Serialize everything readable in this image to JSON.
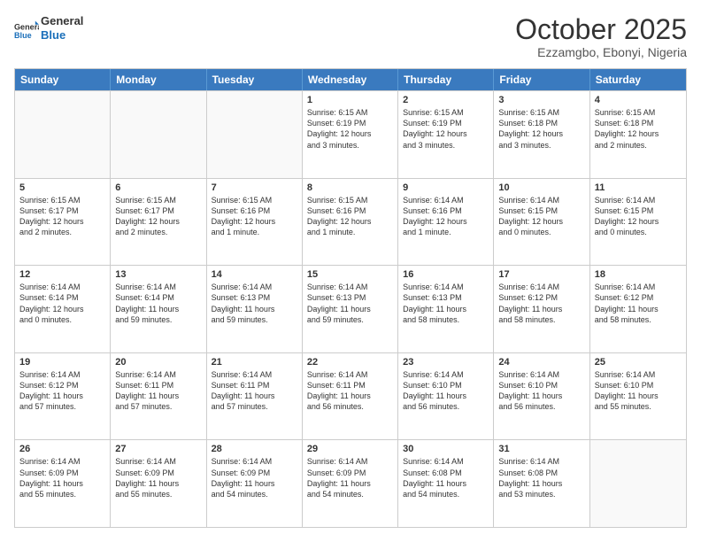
{
  "logo": {
    "general": "General",
    "blue": "Blue"
  },
  "title": "October 2025",
  "location": "Ezzamgbo, Ebonyi, Nigeria",
  "days": [
    "Sunday",
    "Monday",
    "Tuesday",
    "Wednesday",
    "Thursday",
    "Friday",
    "Saturday"
  ],
  "rows": [
    [
      {
        "day": "",
        "lines": [],
        "empty": true
      },
      {
        "day": "",
        "lines": [],
        "empty": true
      },
      {
        "day": "",
        "lines": [],
        "empty": true
      },
      {
        "day": "1",
        "lines": [
          "Sunrise: 6:15 AM",
          "Sunset: 6:19 PM",
          "Daylight: 12 hours",
          "and 3 minutes."
        ]
      },
      {
        "day": "2",
        "lines": [
          "Sunrise: 6:15 AM",
          "Sunset: 6:19 PM",
          "Daylight: 12 hours",
          "and 3 minutes."
        ]
      },
      {
        "day": "3",
        "lines": [
          "Sunrise: 6:15 AM",
          "Sunset: 6:18 PM",
          "Daylight: 12 hours",
          "and 3 minutes."
        ]
      },
      {
        "day": "4",
        "lines": [
          "Sunrise: 6:15 AM",
          "Sunset: 6:18 PM",
          "Daylight: 12 hours",
          "and 2 minutes."
        ]
      }
    ],
    [
      {
        "day": "5",
        "lines": [
          "Sunrise: 6:15 AM",
          "Sunset: 6:17 PM",
          "Daylight: 12 hours",
          "and 2 minutes."
        ]
      },
      {
        "day": "6",
        "lines": [
          "Sunrise: 6:15 AM",
          "Sunset: 6:17 PM",
          "Daylight: 12 hours",
          "and 2 minutes."
        ]
      },
      {
        "day": "7",
        "lines": [
          "Sunrise: 6:15 AM",
          "Sunset: 6:16 PM",
          "Daylight: 12 hours",
          "and 1 minute."
        ]
      },
      {
        "day": "8",
        "lines": [
          "Sunrise: 6:15 AM",
          "Sunset: 6:16 PM",
          "Daylight: 12 hours",
          "and 1 minute."
        ]
      },
      {
        "day": "9",
        "lines": [
          "Sunrise: 6:14 AM",
          "Sunset: 6:16 PM",
          "Daylight: 12 hours",
          "and 1 minute."
        ]
      },
      {
        "day": "10",
        "lines": [
          "Sunrise: 6:14 AM",
          "Sunset: 6:15 PM",
          "Daylight: 12 hours",
          "and 0 minutes."
        ]
      },
      {
        "day": "11",
        "lines": [
          "Sunrise: 6:14 AM",
          "Sunset: 6:15 PM",
          "Daylight: 12 hours",
          "and 0 minutes."
        ]
      }
    ],
    [
      {
        "day": "12",
        "lines": [
          "Sunrise: 6:14 AM",
          "Sunset: 6:14 PM",
          "Daylight: 12 hours",
          "and 0 minutes."
        ]
      },
      {
        "day": "13",
        "lines": [
          "Sunrise: 6:14 AM",
          "Sunset: 6:14 PM",
          "Daylight: 11 hours",
          "and 59 minutes."
        ]
      },
      {
        "day": "14",
        "lines": [
          "Sunrise: 6:14 AM",
          "Sunset: 6:13 PM",
          "Daylight: 11 hours",
          "and 59 minutes."
        ]
      },
      {
        "day": "15",
        "lines": [
          "Sunrise: 6:14 AM",
          "Sunset: 6:13 PM",
          "Daylight: 11 hours",
          "and 59 minutes."
        ]
      },
      {
        "day": "16",
        "lines": [
          "Sunrise: 6:14 AM",
          "Sunset: 6:13 PM",
          "Daylight: 11 hours",
          "and 58 minutes."
        ]
      },
      {
        "day": "17",
        "lines": [
          "Sunrise: 6:14 AM",
          "Sunset: 6:12 PM",
          "Daylight: 11 hours",
          "and 58 minutes."
        ]
      },
      {
        "day": "18",
        "lines": [
          "Sunrise: 6:14 AM",
          "Sunset: 6:12 PM",
          "Daylight: 11 hours",
          "and 58 minutes."
        ]
      }
    ],
    [
      {
        "day": "19",
        "lines": [
          "Sunrise: 6:14 AM",
          "Sunset: 6:12 PM",
          "Daylight: 11 hours",
          "and 57 minutes."
        ]
      },
      {
        "day": "20",
        "lines": [
          "Sunrise: 6:14 AM",
          "Sunset: 6:11 PM",
          "Daylight: 11 hours",
          "and 57 minutes."
        ]
      },
      {
        "day": "21",
        "lines": [
          "Sunrise: 6:14 AM",
          "Sunset: 6:11 PM",
          "Daylight: 11 hours",
          "and 57 minutes."
        ]
      },
      {
        "day": "22",
        "lines": [
          "Sunrise: 6:14 AM",
          "Sunset: 6:11 PM",
          "Daylight: 11 hours",
          "and 56 minutes."
        ]
      },
      {
        "day": "23",
        "lines": [
          "Sunrise: 6:14 AM",
          "Sunset: 6:10 PM",
          "Daylight: 11 hours",
          "and 56 minutes."
        ]
      },
      {
        "day": "24",
        "lines": [
          "Sunrise: 6:14 AM",
          "Sunset: 6:10 PM",
          "Daylight: 11 hours",
          "and 56 minutes."
        ]
      },
      {
        "day": "25",
        "lines": [
          "Sunrise: 6:14 AM",
          "Sunset: 6:10 PM",
          "Daylight: 11 hours",
          "and 55 minutes."
        ]
      }
    ],
    [
      {
        "day": "26",
        "lines": [
          "Sunrise: 6:14 AM",
          "Sunset: 6:09 PM",
          "Daylight: 11 hours",
          "and 55 minutes."
        ]
      },
      {
        "day": "27",
        "lines": [
          "Sunrise: 6:14 AM",
          "Sunset: 6:09 PM",
          "Daylight: 11 hours",
          "and 55 minutes."
        ]
      },
      {
        "day": "28",
        "lines": [
          "Sunrise: 6:14 AM",
          "Sunset: 6:09 PM",
          "Daylight: 11 hours",
          "and 54 minutes."
        ]
      },
      {
        "day": "29",
        "lines": [
          "Sunrise: 6:14 AM",
          "Sunset: 6:09 PM",
          "Daylight: 11 hours",
          "and 54 minutes."
        ]
      },
      {
        "day": "30",
        "lines": [
          "Sunrise: 6:14 AM",
          "Sunset: 6:08 PM",
          "Daylight: 11 hours",
          "and 54 minutes."
        ]
      },
      {
        "day": "31",
        "lines": [
          "Sunrise: 6:14 AM",
          "Sunset: 6:08 PM",
          "Daylight: 11 hours",
          "and 53 minutes."
        ]
      },
      {
        "day": "",
        "lines": [],
        "empty": true
      }
    ]
  ]
}
